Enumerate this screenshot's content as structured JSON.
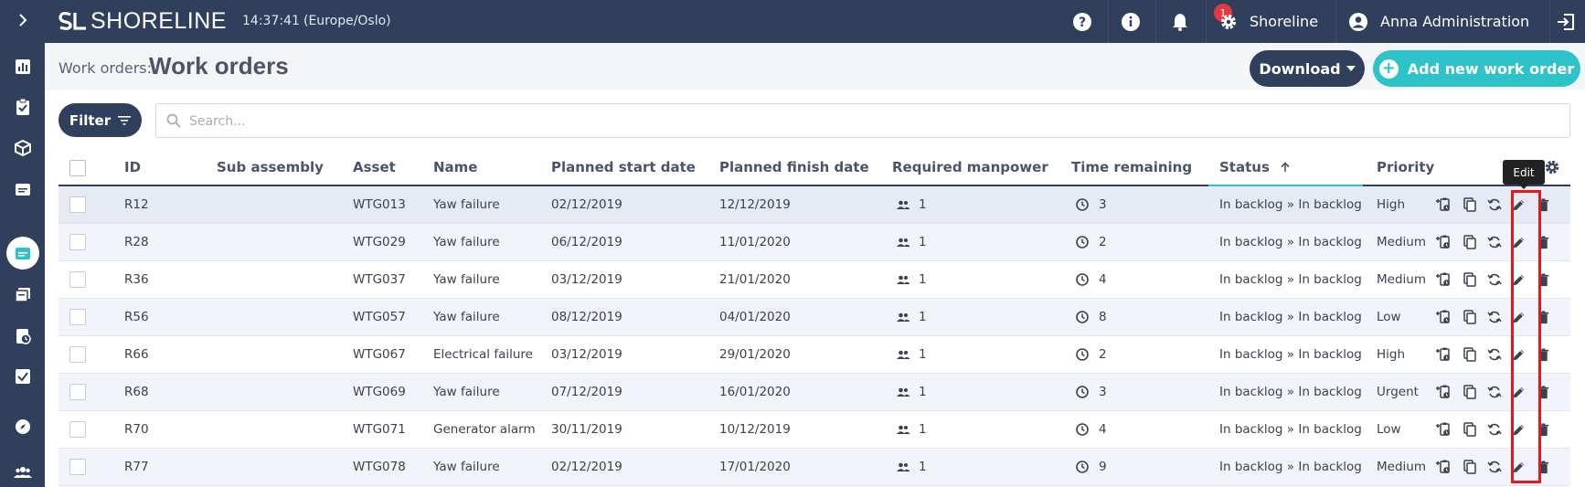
{
  "brand": {
    "logo_text": "SHORELINE"
  },
  "topbar": {
    "time": "14:37:41",
    "timezone": "(Europe/Oslo)",
    "notification_count": "1",
    "site_label": "Shoreline",
    "user_label": "Anna Administration"
  },
  "page": {
    "breadcrumb": "Work orders:",
    "title": "Work orders",
    "download_label": "Download",
    "add_label": "Add new work order"
  },
  "toolbar": {
    "filter_label": "Filter",
    "search_placeholder": "Search..."
  },
  "table": {
    "columns": {
      "id": "ID",
      "sub_assembly": "Sub assembly",
      "asset": "Asset",
      "name": "Name",
      "planned_start": "Planned start date",
      "planned_finish": "Planned finish date",
      "manpower": "Required manpower",
      "time_remaining": "Time remaining",
      "status": "Status",
      "priority": "Priority"
    },
    "rows": [
      {
        "id": "R12",
        "sub": "",
        "asset": "WTG013",
        "name": "Yaw failure",
        "start": "02/12/2019",
        "finish": "12/12/2019",
        "manpower": "1",
        "time": "3",
        "status": "In backlog » In backlog",
        "priority": "High"
      },
      {
        "id": "R28",
        "sub": "",
        "asset": "WTG029",
        "name": "Yaw failure",
        "start": "06/12/2019",
        "finish": "11/01/2020",
        "manpower": "1",
        "time": "2",
        "status": "In backlog » In backlog",
        "priority": "Medium"
      },
      {
        "id": "R36",
        "sub": "",
        "asset": "WTG037",
        "name": "Yaw failure",
        "start": "03/12/2019",
        "finish": "21/01/2020",
        "manpower": "1",
        "time": "4",
        "status": "In backlog » In backlog",
        "priority": "Medium"
      },
      {
        "id": "R56",
        "sub": "",
        "asset": "WTG057",
        "name": "Yaw failure",
        "start": "08/12/2019",
        "finish": "04/01/2020",
        "manpower": "1",
        "time": "8",
        "status": "In backlog » In backlog",
        "priority": "Low"
      },
      {
        "id": "R66",
        "sub": "",
        "asset": "WTG067",
        "name": "Electrical failure",
        "start": "03/12/2019",
        "finish": "29/01/2020",
        "manpower": "1",
        "time": "2",
        "status": "In backlog » In backlog",
        "priority": "High"
      },
      {
        "id": "R68",
        "sub": "",
        "asset": "WTG069",
        "name": "Yaw failure",
        "start": "07/12/2019",
        "finish": "16/01/2020",
        "manpower": "1",
        "time": "3",
        "status": "In backlog » In backlog",
        "priority": "Urgent"
      },
      {
        "id": "R70",
        "sub": "",
        "asset": "WTG071",
        "name": "Generator alarm",
        "start": "30/11/2019",
        "finish": "10/12/2019",
        "manpower": "1",
        "time": "4",
        "status": "In backlog » In backlog",
        "priority": "Low"
      },
      {
        "id": "R77",
        "sub": "",
        "asset": "WTG078",
        "name": "Yaw failure",
        "start": "02/12/2019",
        "finish": "17/01/2020",
        "manpower": "1",
        "time": "9",
        "status": "In backlog » In backlog",
        "priority": "Medium"
      }
    ]
  },
  "tooltip": {
    "text": "Edit"
  },
  "colors": {
    "navy": "#2f3f5c",
    "teal": "#2ec3c9",
    "highlight": "#e3191e",
    "selected_row": "#e6eaf3"
  },
  "icons": [
    "expand-icon",
    "dashboard-icon",
    "checklist-icon",
    "box-icon",
    "folder-icon",
    "work-orders-icon",
    "stack-icon",
    "clipboard-clock-icon",
    "task-check-icon",
    "compass-icon",
    "people-icon",
    "help-icon",
    "info-icon",
    "bell-icon",
    "gear-icon",
    "user-icon",
    "logout-icon",
    "filter-icon",
    "search-icon",
    "people-small-icon",
    "clock-icon",
    "schedule-add-icon",
    "copy-icon",
    "repeat-icon",
    "edit-icon",
    "delete-icon",
    "sort-arrow-up-icon",
    "column-settings-icon",
    "caret-down-icon",
    "plus-icon"
  ]
}
